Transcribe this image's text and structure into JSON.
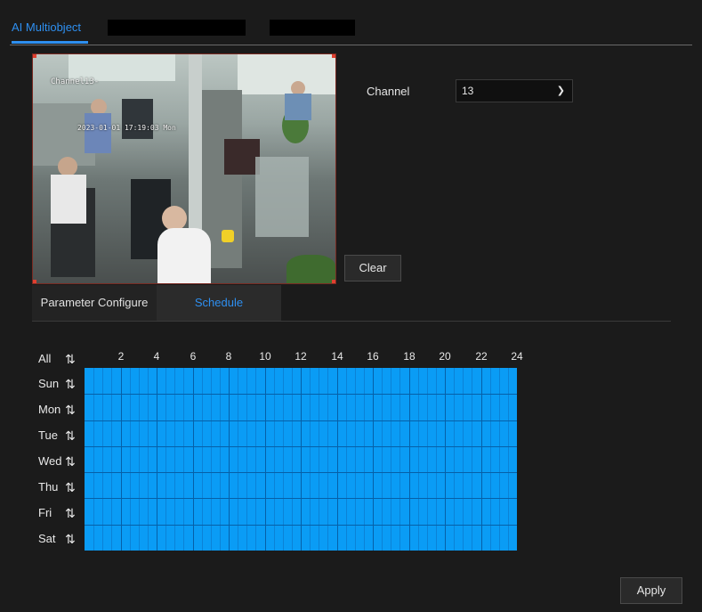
{
  "top_tabs": [
    {
      "label": "AI Multiobject",
      "active": true
    },
    {
      "label": "",
      "redacted": true
    },
    {
      "label": "",
      "redacted": true
    }
  ],
  "preview": {
    "osd_channel": "Channel13-",
    "osd_time": "2023-01-01 17:19:03 Mon"
  },
  "channel": {
    "label": "Channel",
    "value": "13"
  },
  "buttons": {
    "clear": "Clear",
    "apply": "Apply"
  },
  "sub_tabs": [
    {
      "label": "Parameter Configure",
      "active": false
    },
    {
      "label": "Schedule",
      "active": true
    }
  ],
  "schedule": {
    "all_label": "All",
    "days": [
      "Sun",
      "Mon",
      "Tue",
      "Wed",
      "Thu",
      "Fri",
      "Sat"
    ],
    "hour_labels": [
      "2",
      "4",
      "6",
      "8",
      "10",
      "12",
      "14",
      "16",
      "18",
      "20",
      "22",
      "24"
    ],
    "fill_color": "#0a9cf5",
    "all_selected": true
  }
}
